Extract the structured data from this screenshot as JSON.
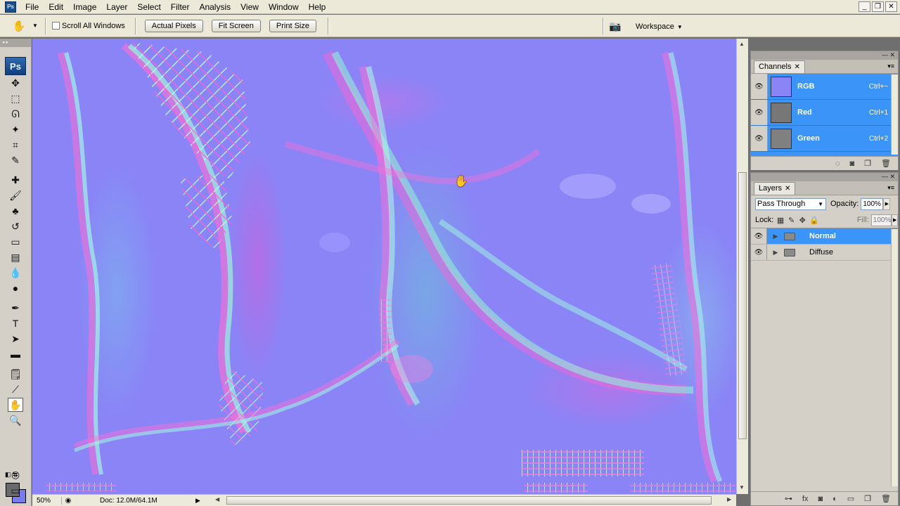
{
  "menu": {
    "app_icon": "Ps",
    "items": [
      "File",
      "Edit",
      "Image",
      "Layer",
      "Select",
      "Filter",
      "Analysis",
      "View",
      "Window",
      "Help"
    ]
  },
  "options": {
    "tool_icon": "hand-icon",
    "scroll_all_windows": "Scroll All Windows",
    "scroll_all_checked": false,
    "buttons": [
      "Actual Pixels",
      "Fit Screen",
      "Print Size"
    ],
    "workspace": "Workspace"
  },
  "tools": {
    "logo": "Ps",
    "active_tool": "hand"
  },
  "status": {
    "zoom": "50%",
    "doc": "Doc: 12.0M/64.1M"
  },
  "channels": {
    "tab": "Channels",
    "rows": [
      {
        "name": "RGB",
        "shortcut": "Ctrl+~"
      },
      {
        "name": "Red",
        "shortcut": "Ctrl+1"
      },
      {
        "name": "Green",
        "shortcut": "Ctrl+2"
      }
    ]
  },
  "layers": {
    "tab": "Layers",
    "blend_mode": "Pass Through",
    "opacity_label": "Opacity:",
    "opacity": "100%",
    "lock_label": "Lock:",
    "fill_label": "Fill:",
    "fill": "100%",
    "rows": [
      {
        "name": "Normal",
        "selected": true
      },
      {
        "name": "Diffuse",
        "selected": false
      }
    ]
  },
  "colors": {
    "canvas_base": "#8a84f6",
    "selection": "#3b94f7",
    "foreground": "#6a6a6a",
    "background_swatch": "#7a7af0"
  }
}
